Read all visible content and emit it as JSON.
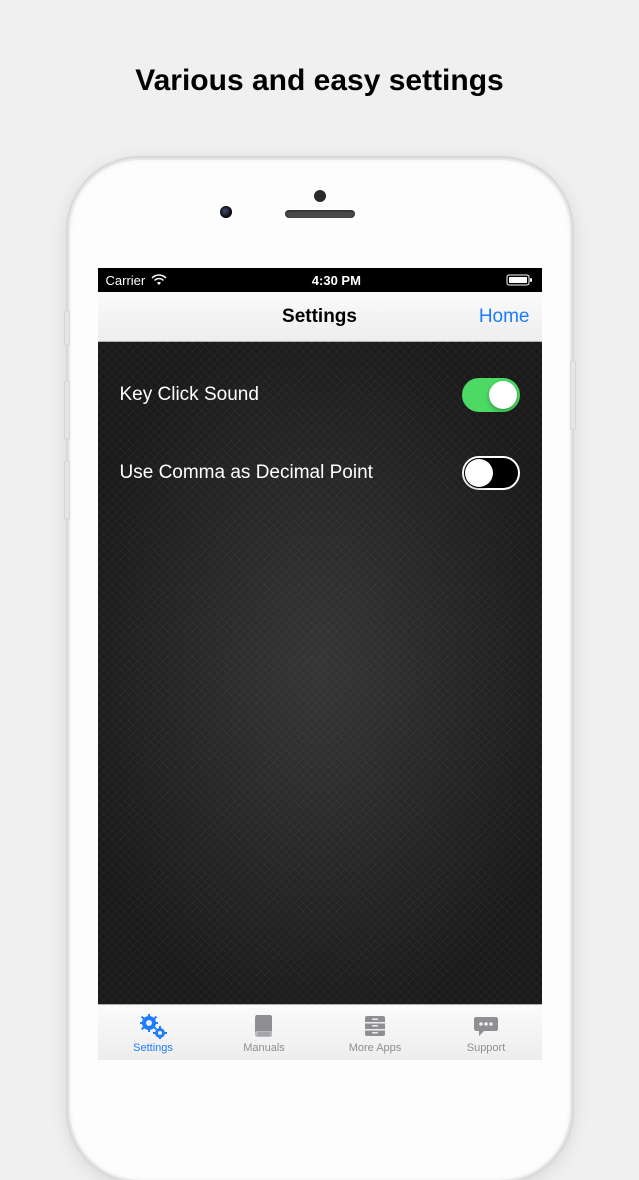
{
  "promo": {
    "title": "Various and easy settings"
  },
  "status": {
    "carrier": "Carrier",
    "time": "4:30 PM"
  },
  "nav": {
    "title": "Settings",
    "home": "Home"
  },
  "settings": {
    "keyClick": {
      "label": "Key Click Sound",
      "on": true
    },
    "comma": {
      "label": "Use Comma as Decimal Point",
      "on": false
    }
  },
  "tabs": {
    "settings": "Settings",
    "manuals": "Manuals",
    "moreApps": "More Apps",
    "support": "Support"
  }
}
